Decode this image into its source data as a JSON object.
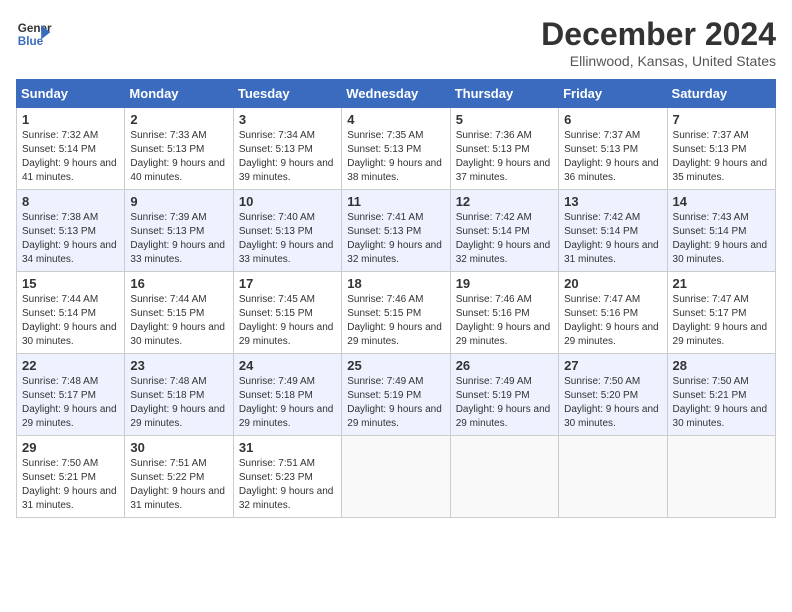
{
  "header": {
    "logo_line1": "General",
    "logo_line2": "Blue",
    "month_year": "December 2024",
    "location": "Ellinwood, Kansas, United States"
  },
  "days_of_week": [
    "Sunday",
    "Monday",
    "Tuesday",
    "Wednesday",
    "Thursday",
    "Friday",
    "Saturday"
  ],
  "weeks": [
    [
      {
        "day": "1",
        "sunrise": "7:32 AM",
        "sunset": "5:14 PM",
        "daylight": "9 hours and 41 minutes."
      },
      {
        "day": "2",
        "sunrise": "7:33 AM",
        "sunset": "5:13 PM",
        "daylight": "9 hours and 40 minutes."
      },
      {
        "day": "3",
        "sunrise": "7:34 AM",
        "sunset": "5:13 PM",
        "daylight": "9 hours and 39 minutes."
      },
      {
        "day": "4",
        "sunrise": "7:35 AM",
        "sunset": "5:13 PM",
        "daylight": "9 hours and 38 minutes."
      },
      {
        "day": "5",
        "sunrise": "7:36 AM",
        "sunset": "5:13 PM",
        "daylight": "9 hours and 37 minutes."
      },
      {
        "day": "6",
        "sunrise": "7:37 AM",
        "sunset": "5:13 PM",
        "daylight": "9 hours and 36 minutes."
      },
      {
        "day": "7",
        "sunrise": "7:37 AM",
        "sunset": "5:13 PM",
        "daylight": "9 hours and 35 minutes."
      }
    ],
    [
      {
        "day": "8",
        "sunrise": "7:38 AM",
        "sunset": "5:13 PM",
        "daylight": "9 hours and 34 minutes."
      },
      {
        "day": "9",
        "sunrise": "7:39 AM",
        "sunset": "5:13 PM",
        "daylight": "9 hours and 33 minutes."
      },
      {
        "day": "10",
        "sunrise": "7:40 AM",
        "sunset": "5:13 PM",
        "daylight": "9 hours and 33 minutes."
      },
      {
        "day": "11",
        "sunrise": "7:41 AM",
        "sunset": "5:13 PM",
        "daylight": "9 hours and 32 minutes."
      },
      {
        "day": "12",
        "sunrise": "7:42 AM",
        "sunset": "5:14 PM",
        "daylight": "9 hours and 32 minutes."
      },
      {
        "day": "13",
        "sunrise": "7:42 AM",
        "sunset": "5:14 PM",
        "daylight": "9 hours and 31 minutes."
      },
      {
        "day": "14",
        "sunrise": "7:43 AM",
        "sunset": "5:14 PM",
        "daylight": "9 hours and 30 minutes."
      }
    ],
    [
      {
        "day": "15",
        "sunrise": "7:44 AM",
        "sunset": "5:14 PM",
        "daylight": "9 hours and 30 minutes."
      },
      {
        "day": "16",
        "sunrise": "7:44 AM",
        "sunset": "5:15 PM",
        "daylight": "9 hours and 30 minutes."
      },
      {
        "day": "17",
        "sunrise": "7:45 AM",
        "sunset": "5:15 PM",
        "daylight": "9 hours and 29 minutes."
      },
      {
        "day": "18",
        "sunrise": "7:46 AM",
        "sunset": "5:15 PM",
        "daylight": "9 hours and 29 minutes."
      },
      {
        "day": "19",
        "sunrise": "7:46 AM",
        "sunset": "5:16 PM",
        "daylight": "9 hours and 29 minutes."
      },
      {
        "day": "20",
        "sunrise": "7:47 AM",
        "sunset": "5:16 PM",
        "daylight": "9 hours and 29 minutes."
      },
      {
        "day": "21",
        "sunrise": "7:47 AM",
        "sunset": "5:17 PM",
        "daylight": "9 hours and 29 minutes."
      }
    ],
    [
      {
        "day": "22",
        "sunrise": "7:48 AM",
        "sunset": "5:17 PM",
        "daylight": "9 hours and 29 minutes."
      },
      {
        "day": "23",
        "sunrise": "7:48 AM",
        "sunset": "5:18 PM",
        "daylight": "9 hours and 29 minutes."
      },
      {
        "day": "24",
        "sunrise": "7:49 AM",
        "sunset": "5:18 PM",
        "daylight": "9 hours and 29 minutes."
      },
      {
        "day": "25",
        "sunrise": "7:49 AM",
        "sunset": "5:19 PM",
        "daylight": "9 hours and 29 minutes."
      },
      {
        "day": "26",
        "sunrise": "7:49 AM",
        "sunset": "5:19 PM",
        "daylight": "9 hours and 29 minutes."
      },
      {
        "day": "27",
        "sunrise": "7:50 AM",
        "sunset": "5:20 PM",
        "daylight": "9 hours and 30 minutes."
      },
      {
        "day": "28",
        "sunrise": "7:50 AM",
        "sunset": "5:21 PM",
        "daylight": "9 hours and 30 minutes."
      }
    ],
    [
      {
        "day": "29",
        "sunrise": "7:50 AM",
        "sunset": "5:21 PM",
        "daylight": "9 hours and 31 minutes."
      },
      {
        "day": "30",
        "sunrise": "7:51 AM",
        "sunset": "5:22 PM",
        "daylight": "9 hours and 31 minutes."
      },
      {
        "day": "31",
        "sunrise": "7:51 AM",
        "sunset": "5:23 PM",
        "daylight": "9 hours and 32 minutes."
      },
      null,
      null,
      null,
      null
    ]
  ]
}
